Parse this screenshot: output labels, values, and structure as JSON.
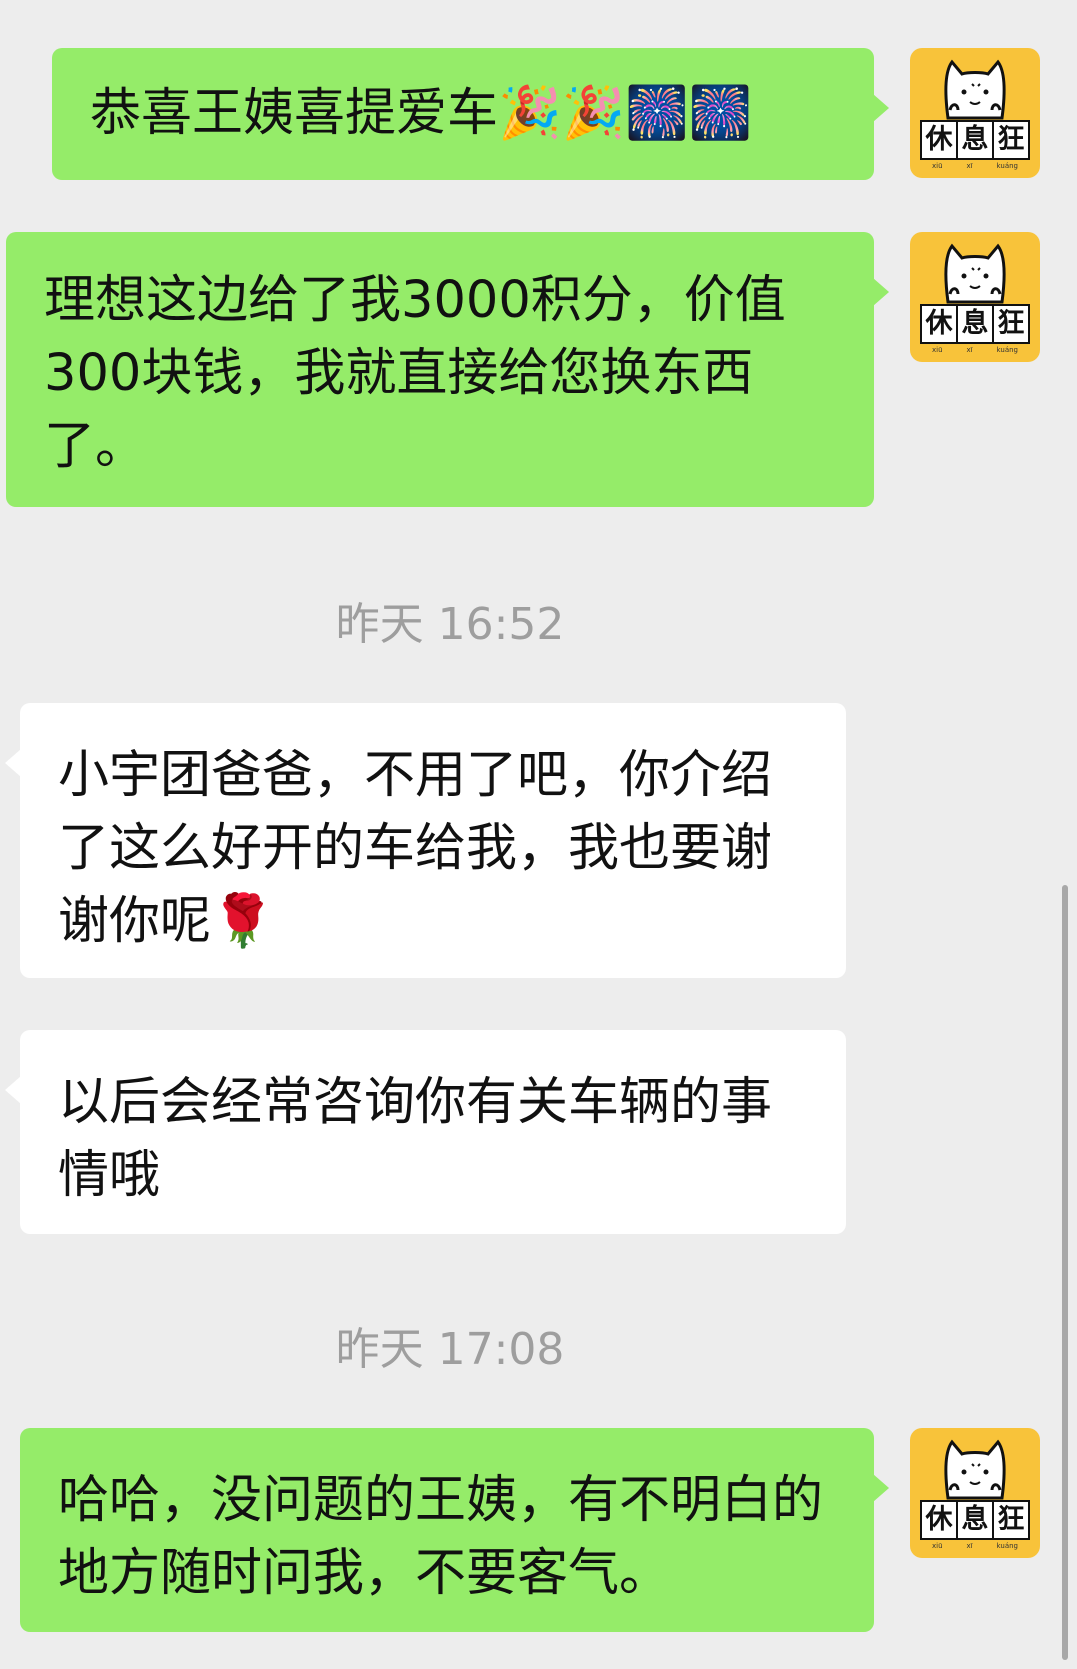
{
  "messages": [
    {
      "text": "恭喜王姨喜提爱车🎉🎉🎆🎆"
    },
    {
      "text": "理想这边给了我3000积分，价值300块钱，我就直接给您换东西了。"
    },
    {
      "text": "小宇团爸爸，不用了吧，你介绍了这么好开的车给我，我也要谢谢你呢🌹"
    },
    {
      "text": "以后会经常咨询你有关车辆的事情哦"
    },
    {
      "text": "哈哈，没问题的王姨，有不明白的地方随时问我，不要客气。"
    }
  ],
  "timestamps": [
    "昨天 16:52",
    "昨天 17:08"
  ],
  "avatar": {
    "icon": "cat-mascot-icon",
    "logo_chars": [
      "休",
      "息",
      "狂"
    ],
    "pinyin": [
      "xiū",
      "xī",
      "kuáng"
    ],
    "background": "#f8c33a"
  },
  "colors": {
    "outgoing_bubble": "#95ec69",
    "incoming_bubble": "#ffffff",
    "background": "#ededed",
    "timestamp": "#9e9e9e"
  }
}
